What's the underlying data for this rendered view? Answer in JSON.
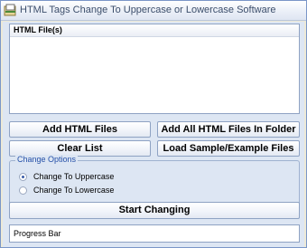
{
  "window": {
    "title": "HTML Tags Change To Uppercase or Lowercase Software"
  },
  "file_list": {
    "column_header": "HTML File(s)",
    "rows": []
  },
  "buttons": {
    "add_files": "Add HTML Files",
    "add_folder": "Add All HTML Files In Folder",
    "clear_list": "Clear List",
    "load_sample": "Load Sample/Example Files",
    "start": "Start Changing"
  },
  "change_options": {
    "title": "Change Options",
    "selected": "Change To Uppercase",
    "options": [
      "Change To Uppercase",
      "Change To Lowercase"
    ]
  },
  "progress": {
    "label": "Progress Bar",
    "value": 0
  },
  "colors": {
    "accent": "#2550a8"
  }
}
